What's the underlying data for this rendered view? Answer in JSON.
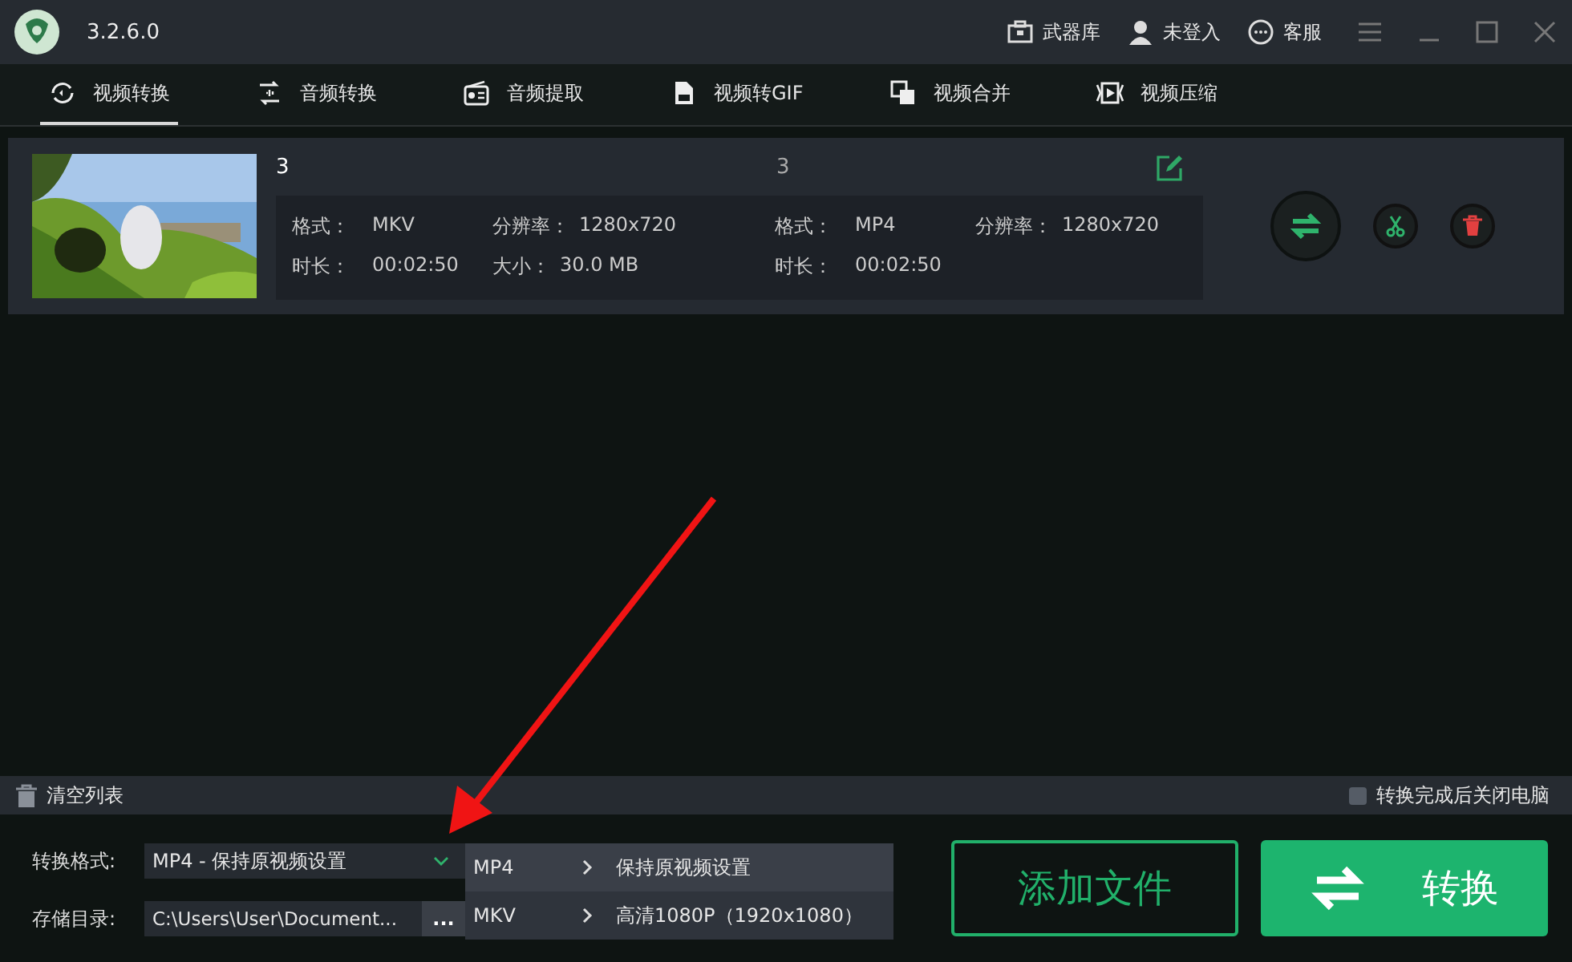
{
  "window": {
    "version": "3.2.6.0"
  },
  "header_links": [
    {
      "kind": "toolbox",
      "label": "武器库"
    },
    {
      "kind": "user",
      "label": "未登入"
    },
    {
      "kind": "chat",
      "label": "客服"
    }
  ],
  "tabs": [
    {
      "kind": "video-convert",
      "label": "视频转换",
      "selected": true
    },
    {
      "kind": "audio-convert",
      "label": "音频转换",
      "selected": false
    },
    {
      "kind": "radio",
      "label": "音频提取",
      "selected": false
    },
    {
      "kind": "file",
      "label": "视频转GIF",
      "selected": false
    },
    {
      "kind": "merge",
      "label": "视频合并",
      "selected": false
    },
    {
      "kind": "compress",
      "label": "视频压缩",
      "selected": false
    }
  ],
  "files": [
    {
      "name": "3",
      "output_name": "3",
      "source": [
        {
          "label": "格式：",
          "value": "MKV"
        },
        {
          "label": "分辨率：",
          "value": "1280x720"
        },
        {
          "label": "时长：",
          "value": "00:02:50"
        },
        {
          "label": "大小：",
          "value": "30.0 MB"
        }
      ],
      "target": [
        {
          "label": "格式：",
          "value": "MP4"
        },
        {
          "label": "分辨率：",
          "value": "1280x720"
        },
        {
          "label": "时长：",
          "value": "00:02:50"
        }
      ]
    }
  ],
  "clear_list": "清空列表",
  "shutdown_option": {
    "label": "转换完成后关闭电脑",
    "checked": false
  },
  "format_field": {
    "label": "转换格式:",
    "value": "MP4 - 保持原视频设置"
  },
  "output_dir": {
    "label": "存储目录:",
    "value": "C:\\Users\\User\\Document...",
    "button": "..."
  },
  "format_menu": [
    {
      "format": "MP4",
      "preset": "保持原视频设置",
      "selected": true
    },
    {
      "format": "MKV",
      "preset": "高清1080P（1920x1080）",
      "selected": false
    }
  ],
  "add_button": "添加文件",
  "convert_button": "转换"
}
